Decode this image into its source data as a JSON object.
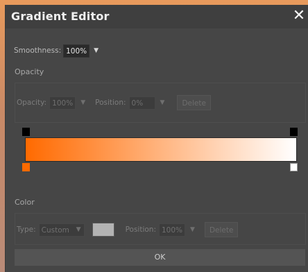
{
  "dialog": {
    "title": "Gradient Editor",
    "close_glyph": "✕"
  },
  "smoothness": {
    "label": "Smoothness:",
    "value": "100%",
    "caret": "▼"
  },
  "opacity_section": {
    "title": "Opacity",
    "opacity_label": "Opacity:",
    "opacity_value": "100%",
    "position_label": "Position:",
    "position_value": "0%",
    "delete_label": "Delete",
    "caret": "▼"
  },
  "gradient": {
    "start_color": "#ff6a00",
    "end_color": "#ffffff",
    "opacity_stop_colors": [
      "#000000",
      "#000000"
    ],
    "color_stop_colors": [
      "#ff6a00",
      "#ffffff"
    ]
  },
  "color_section": {
    "title": "Color",
    "type_label": "Type:",
    "type_value": "Custom",
    "swatch_color": "#b3b3b3",
    "position_label": "Position:",
    "position_value": "100%",
    "delete_label": "Delete",
    "caret": "▼"
  },
  "ok_label": "OK"
}
